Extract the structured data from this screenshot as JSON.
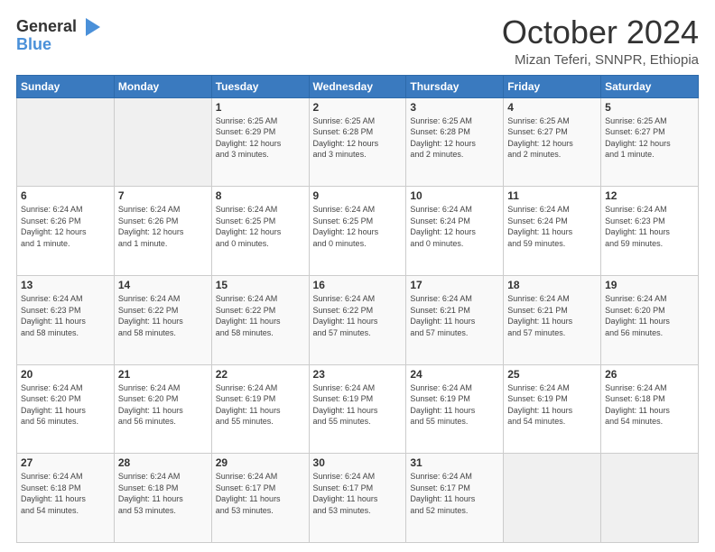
{
  "logo": {
    "line1": "General",
    "line2": "Blue",
    "icon": "▶"
  },
  "title": "October 2024",
  "location": "Mizan Teferi, SNNPR, Ethiopia",
  "days_of_week": [
    "Sunday",
    "Monday",
    "Tuesday",
    "Wednesday",
    "Thursday",
    "Friday",
    "Saturday"
  ],
  "weeks": [
    [
      {
        "day": "",
        "info": ""
      },
      {
        "day": "",
        "info": ""
      },
      {
        "day": "1",
        "info": "Sunrise: 6:25 AM\nSunset: 6:29 PM\nDaylight: 12 hours\nand 3 minutes."
      },
      {
        "day": "2",
        "info": "Sunrise: 6:25 AM\nSunset: 6:28 PM\nDaylight: 12 hours\nand 3 minutes."
      },
      {
        "day": "3",
        "info": "Sunrise: 6:25 AM\nSunset: 6:28 PM\nDaylight: 12 hours\nand 2 minutes."
      },
      {
        "day": "4",
        "info": "Sunrise: 6:25 AM\nSunset: 6:27 PM\nDaylight: 12 hours\nand 2 minutes."
      },
      {
        "day": "5",
        "info": "Sunrise: 6:25 AM\nSunset: 6:27 PM\nDaylight: 12 hours\nand 1 minute."
      }
    ],
    [
      {
        "day": "6",
        "info": "Sunrise: 6:24 AM\nSunset: 6:26 PM\nDaylight: 12 hours\nand 1 minute."
      },
      {
        "day": "7",
        "info": "Sunrise: 6:24 AM\nSunset: 6:26 PM\nDaylight: 12 hours\nand 1 minute."
      },
      {
        "day": "8",
        "info": "Sunrise: 6:24 AM\nSunset: 6:25 PM\nDaylight: 12 hours\nand 0 minutes."
      },
      {
        "day": "9",
        "info": "Sunrise: 6:24 AM\nSunset: 6:25 PM\nDaylight: 12 hours\nand 0 minutes."
      },
      {
        "day": "10",
        "info": "Sunrise: 6:24 AM\nSunset: 6:24 PM\nDaylight: 12 hours\nand 0 minutes."
      },
      {
        "day": "11",
        "info": "Sunrise: 6:24 AM\nSunset: 6:24 PM\nDaylight: 11 hours\nand 59 minutes."
      },
      {
        "day": "12",
        "info": "Sunrise: 6:24 AM\nSunset: 6:23 PM\nDaylight: 11 hours\nand 59 minutes."
      }
    ],
    [
      {
        "day": "13",
        "info": "Sunrise: 6:24 AM\nSunset: 6:23 PM\nDaylight: 11 hours\nand 58 minutes."
      },
      {
        "day": "14",
        "info": "Sunrise: 6:24 AM\nSunset: 6:22 PM\nDaylight: 11 hours\nand 58 minutes."
      },
      {
        "day": "15",
        "info": "Sunrise: 6:24 AM\nSunset: 6:22 PM\nDaylight: 11 hours\nand 58 minutes."
      },
      {
        "day": "16",
        "info": "Sunrise: 6:24 AM\nSunset: 6:22 PM\nDaylight: 11 hours\nand 57 minutes."
      },
      {
        "day": "17",
        "info": "Sunrise: 6:24 AM\nSunset: 6:21 PM\nDaylight: 11 hours\nand 57 minutes."
      },
      {
        "day": "18",
        "info": "Sunrise: 6:24 AM\nSunset: 6:21 PM\nDaylight: 11 hours\nand 57 minutes."
      },
      {
        "day": "19",
        "info": "Sunrise: 6:24 AM\nSunset: 6:20 PM\nDaylight: 11 hours\nand 56 minutes."
      }
    ],
    [
      {
        "day": "20",
        "info": "Sunrise: 6:24 AM\nSunset: 6:20 PM\nDaylight: 11 hours\nand 56 minutes."
      },
      {
        "day": "21",
        "info": "Sunrise: 6:24 AM\nSunset: 6:20 PM\nDaylight: 11 hours\nand 56 minutes."
      },
      {
        "day": "22",
        "info": "Sunrise: 6:24 AM\nSunset: 6:19 PM\nDaylight: 11 hours\nand 55 minutes."
      },
      {
        "day": "23",
        "info": "Sunrise: 6:24 AM\nSunset: 6:19 PM\nDaylight: 11 hours\nand 55 minutes."
      },
      {
        "day": "24",
        "info": "Sunrise: 6:24 AM\nSunset: 6:19 PM\nDaylight: 11 hours\nand 55 minutes."
      },
      {
        "day": "25",
        "info": "Sunrise: 6:24 AM\nSunset: 6:19 PM\nDaylight: 11 hours\nand 54 minutes."
      },
      {
        "day": "26",
        "info": "Sunrise: 6:24 AM\nSunset: 6:18 PM\nDaylight: 11 hours\nand 54 minutes."
      }
    ],
    [
      {
        "day": "27",
        "info": "Sunrise: 6:24 AM\nSunset: 6:18 PM\nDaylight: 11 hours\nand 54 minutes."
      },
      {
        "day": "28",
        "info": "Sunrise: 6:24 AM\nSunset: 6:18 PM\nDaylight: 11 hours\nand 53 minutes."
      },
      {
        "day": "29",
        "info": "Sunrise: 6:24 AM\nSunset: 6:17 PM\nDaylight: 11 hours\nand 53 minutes."
      },
      {
        "day": "30",
        "info": "Sunrise: 6:24 AM\nSunset: 6:17 PM\nDaylight: 11 hours\nand 53 minutes."
      },
      {
        "day": "31",
        "info": "Sunrise: 6:24 AM\nSunset: 6:17 PM\nDaylight: 11 hours\nand 52 minutes."
      },
      {
        "day": "",
        "info": ""
      },
      {
        "day": "",
        "info": ""
      }
    ]
  ]
}
